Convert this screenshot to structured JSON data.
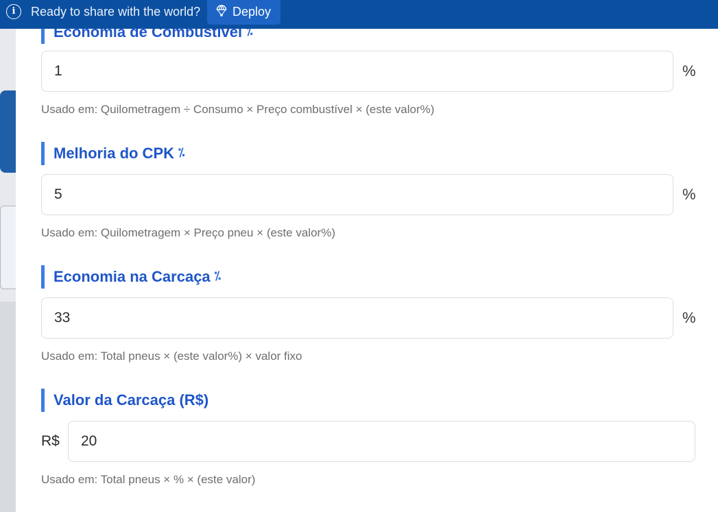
{
  "banner": {
    "message": "Ready to share with the world?",
    "deploy_label": "Deploy"
  },
  "fields": [
    {
      "title": "Economia de Combustível",
      "value": "1",
      "unit": "%",
      "help": "Usado em: Quilometragem ÷ Consumo × Preço combustível × (este valor%)"
    },
    {
      "title": "Melhoria do CPK",
      "value": "5",
      "unit": "%",
      "help": "Usado em: Quilometragem × Preço pneu × (este valor%)"
    },
    {
      "title": "Economia na Carcaça",
      "value": "33",
      "unit": "%",
      "help": "Usado em: Total pneus × (este valor%) × valor fixo"
    },
    {
      "title": "Valor da Carcaça (R$)",
      "value": "20",
      "prefix": "R$",
      "help": "Usado em: Total pneus × % × (este valor)"
    }
  ],
  "icons": {
    "title_percent_glyph": "percent-icon",
    "banner_info": "info-icon",
    "deploy": "deploy-icon"
  },
  "colors": {
    "banner_bg": "#0b4fa0",
    "deploy_bg": "#1d64c4",
    "title_text": "#1f56c9",
    "title_accent": "#3b7de8"
  }
}
